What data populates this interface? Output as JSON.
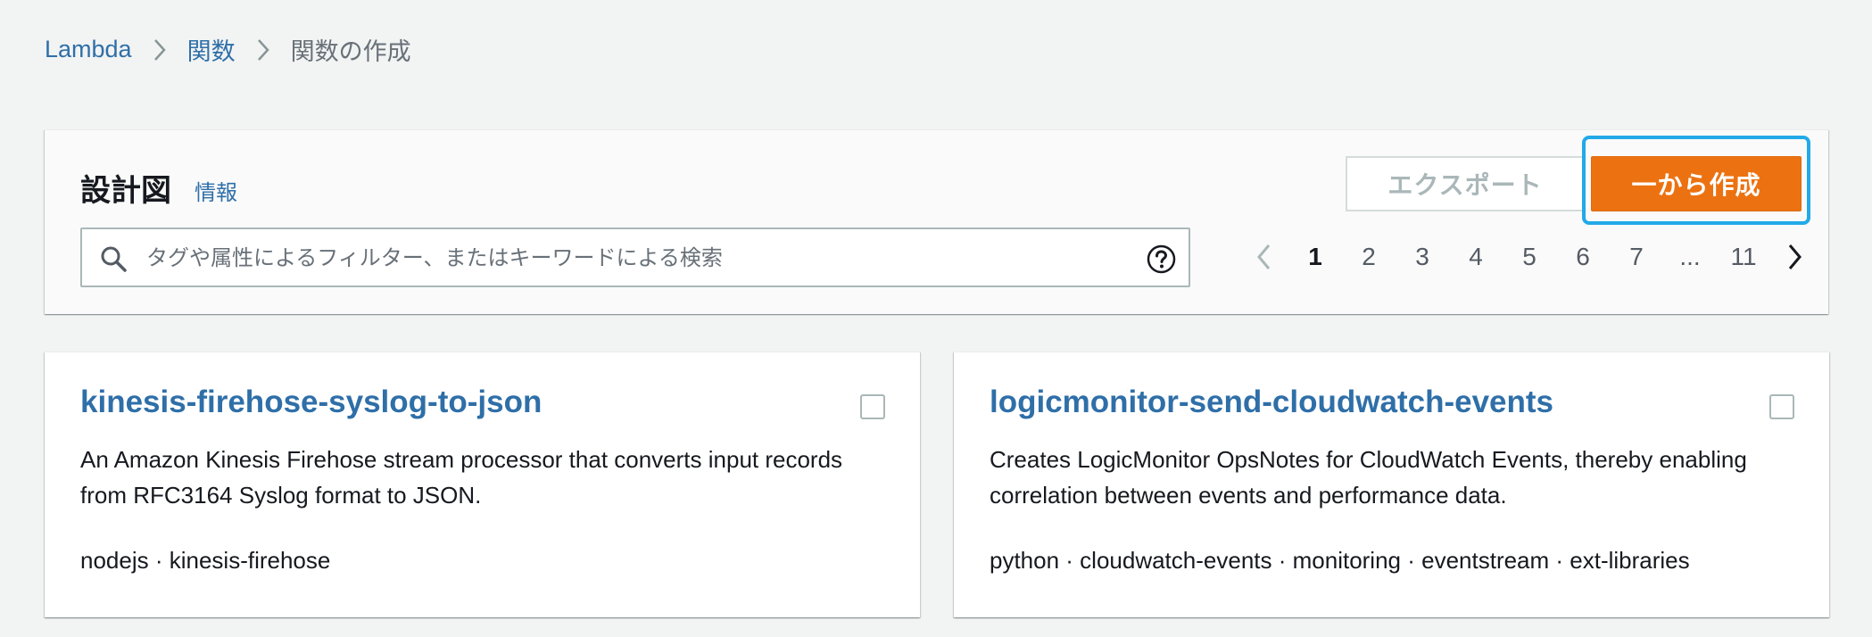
{
  "breadcrumb": {
    "items": [
      "Lambda",
      "関数"
    ],
    "current": "関数の作成"
  },
  "blueprints": {
    "title": "設計図",
    "info_link": "情報",
    "export_button": "エクスポート",
    "create_button": "一から作成",
    "search": {
      "placeholder": "タグや属性によるフィルター、またはキーワードによる検索",
      "value": ""
    },
    "pagination": {
      "pages": [
        "1",
        "2",
        "3",
        "4",
        "5",
        "6",
        "7",
        "...",
        "11"
      ],
      "current": "1"
    }
  },
  "cards": [
    {
      "title": "kinesis-firehose-syslog-to-json",
      "description": "An Amazon Kinesis Firehose stream processor that converts input records from RFC3164 Syslog format to JSON.",
      "tags": "nodejs · kinesis-firehose",
      "checked": false
    },
    {
      "title": "logicmonitor-send-cloudwatch-events",
      "description": "Creates LogicMonitor OpsNotes for CloudWatch Events, thereby enabling correlation between events and performance data.",
      "tags": "python · cloudwatch-events · monitoring · eventstream · ext-libraries",
      "checked": false
    }
  ],
  "colors": {
    "link": "#2f6fa8",
    "primary_button": "#ec7211",
    "focus_ring": "#22a9e8",
    "background": "#f2f3f3"
  },
  "icons": [
    "chevron-right-icon",
    "search-icon",
    "help-icon",
    "chevron-left-icon"
  ]
}
